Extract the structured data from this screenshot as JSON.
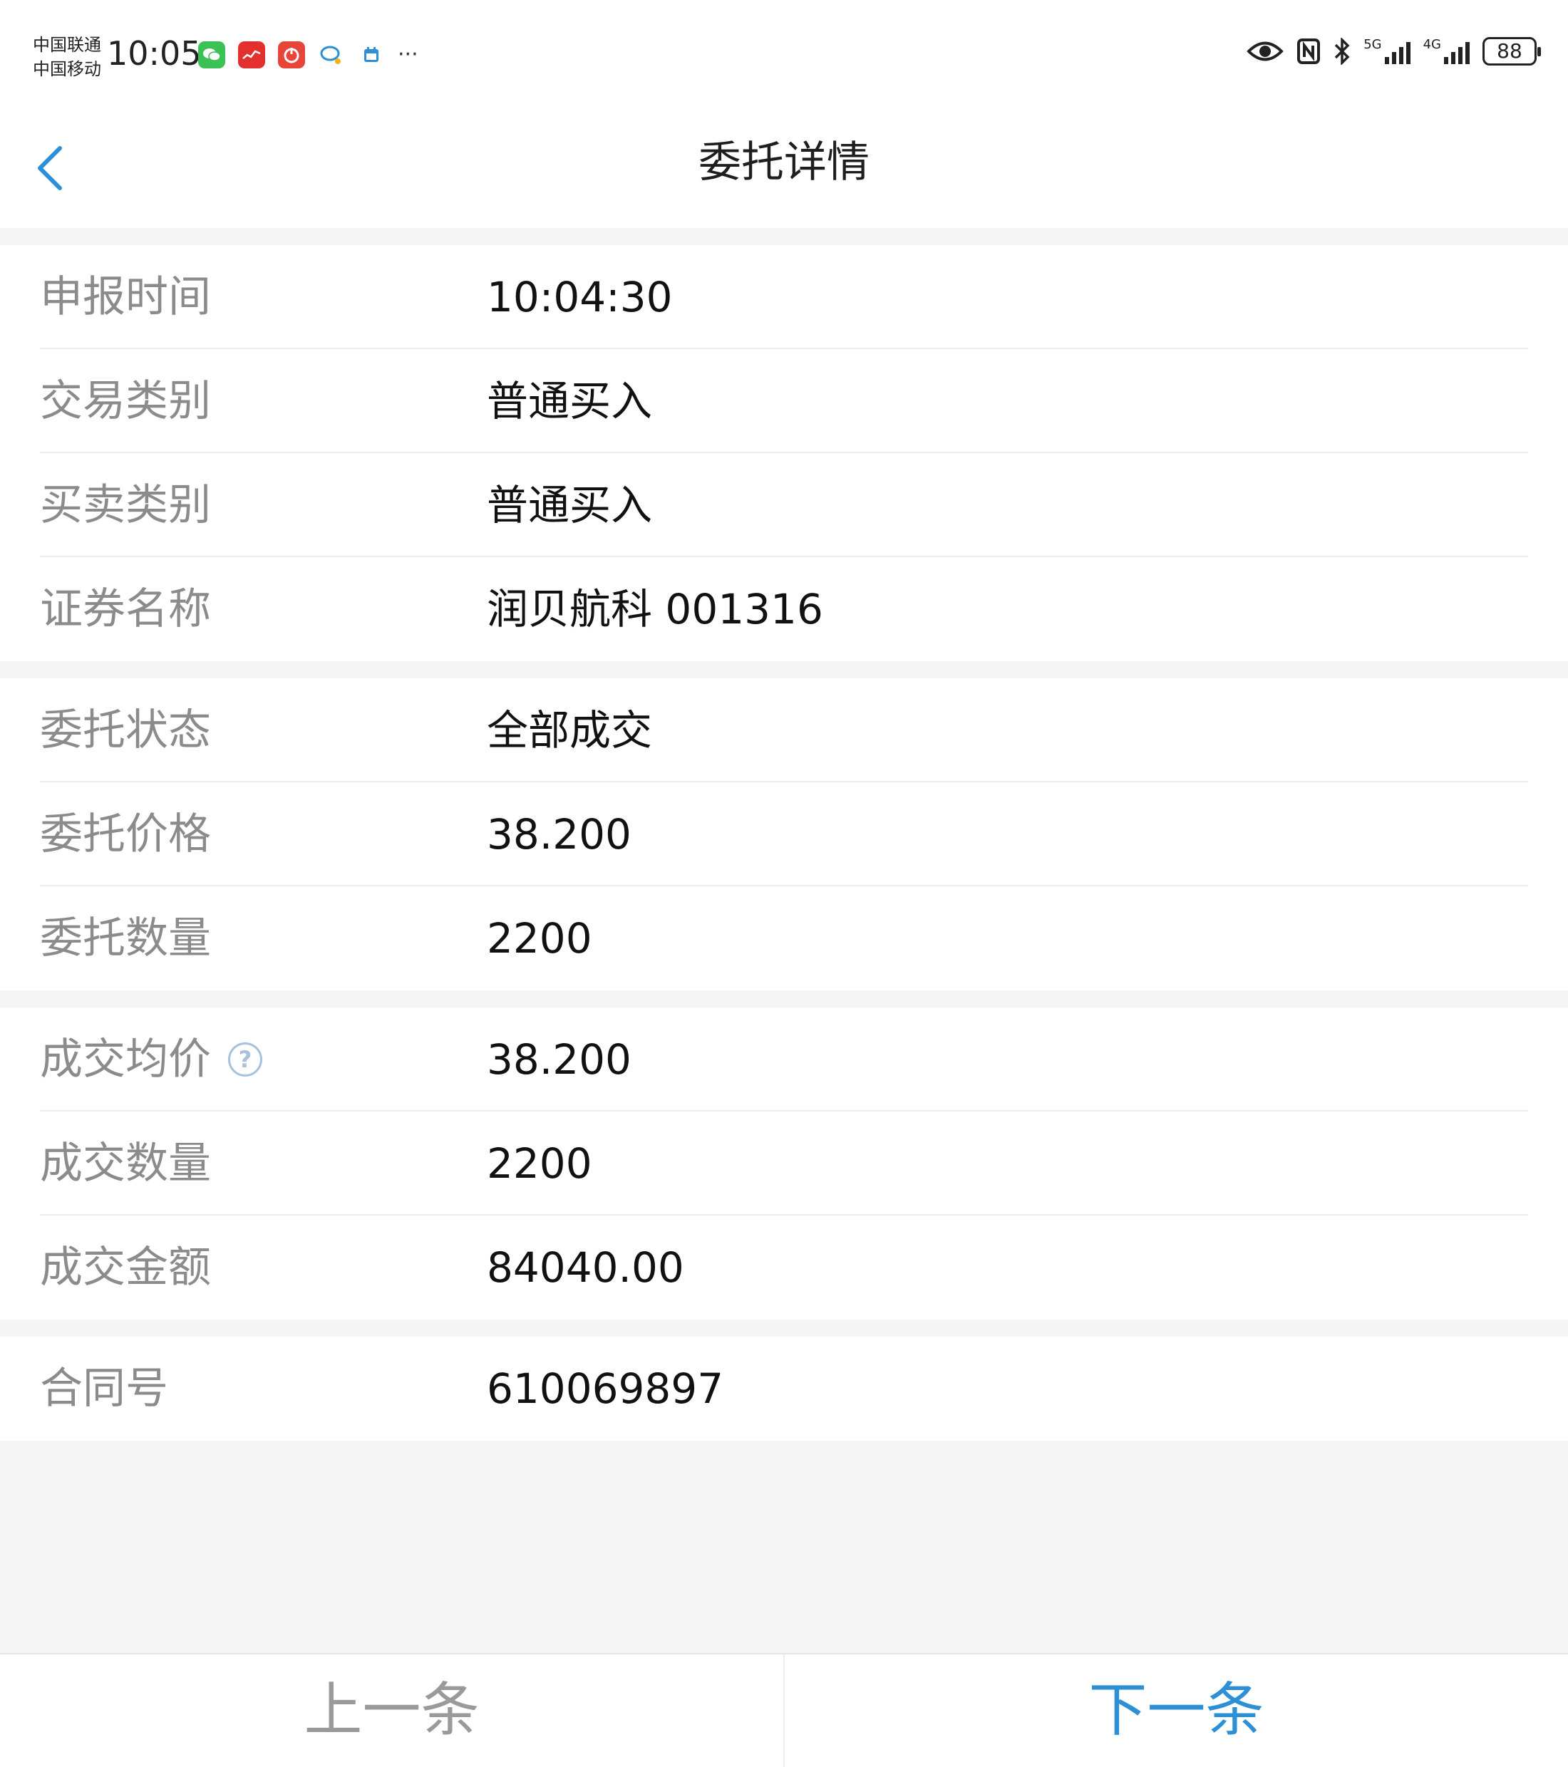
{
  "status_bar": {
    "carrier_1": "中国联通",
    "carrier_2": "中国移动",
    "time": "10:05",
    "network_1": "5G",
    "network_2": "4G",
    "battery": "88",
    "more": "···"
  },
  "header": {
    "title": "委托详情"
  },
  "sections": [
    {
      "rows": [
        {
          "label": "申报时间",
          "value": "10:04:30"
        },
        {
          "label": "交易类别",
          "value": "普通买入"
        },
        {
          "label": "买卖类别",
          "value": "普通买入"
        },
        {
          "label": "证券名称",
          "value": "润贝航科 001316"
        }
      ]
    },
    {
      "rows": [
        {
          "label": "委托状态",
          "value": "全部成交"
        },
        {
          "label": "委托价格",
          "value": "38.200"
        },
        {
          "label": "委托数量",
          "value": "2200"
        }
      ]
    },
    {
      "rows": [
        {
          "label": "成交均价",
          "value": "38.200",
          "help": "?"
        },
        {
          "label": "成交数量",
          "value": "2200"
        },
        {
          "label": "成交金额",
          "value": "84040.00"
        }
      ]
    },
    {
      "rows": [
        {
          "label": "合同号",
          "value": "610069897"
        }
      ]
    }
  ],
  "bottom_bar": {
    "prev_label": "上一条",
    "next_label": "下一条"
  },
  "colors": {
    "accent": "#2d8fd5",
    "label": "#8b8b8b",
    "value": "#111111",
    "background": "#f5f5f5"
  }
}
